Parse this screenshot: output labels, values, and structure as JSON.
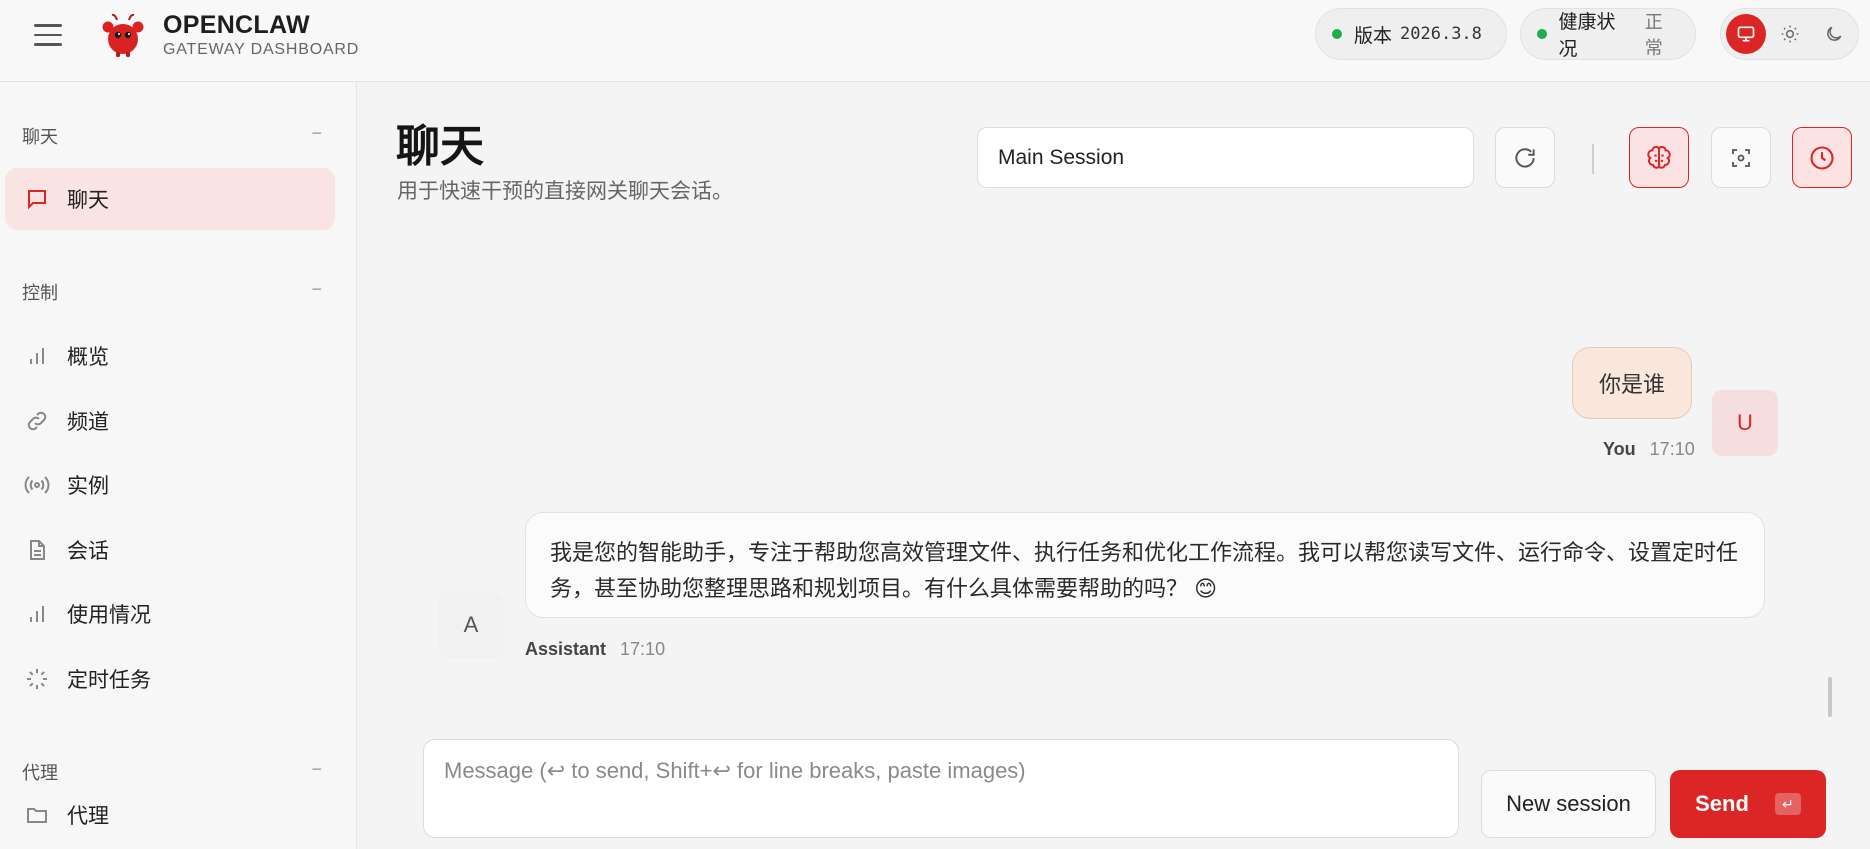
{
  "header": {
    "brand_title": "OPENCLAW",
    "brand_subtitle": "GATEWAY DASHBOARD",
    "version_label": "版本",
    "version_value": "2026.3.8",
    "health_label": "健康状况",
    "health_value": "正常",
    "status_color": "#1fae4e",
    "accent_color": "#dc2626"
  },
  "sidebar": {
    "sections": [
      {
        "title": "聊天",
        "collapse": "−"
      },
      {
        "title": "控制",
        "collapse": "−"
      },
      {
        "title": "代理",
        "collapse": "−"
      }
    ],
    "items": [
      {
        "label": "聊天",
        "icon": "message-icon",
        "active": true
      },
      {
        "label": "概览",
        "icon": "bar-chart-icon"
      },
      {
        "label": "频道",
        "icon": "link-icon"
      },
      {
        "label": "实例",
        "icon": "broadcast-icon"
      },
      {
        "label": "会话",
        "icon": "document-icon"
      },
      {
        "label": "使用情况",
        "icon": "bar-chart-icon"
      },
      {
        "label": "定时任务",
        "icon": "loader-icon"
      },
      {
        "label": "代理",
        "icon": "folder-icon"
      }
    ]
  },
  "main": {
    "title": "聊天",
    "subtitle": "用于快速干预的直接网关聊天会话。",
    "session_value": "Main Session",
    "toolbar_icons": [
      "refresh-icon",
      "brain-icon",
      "focus-icon",
      "clock-icon"
    ]
  },
  "chat": {
    "messages": [
      {
        "role": "user",
        "avatar": "U",
        "text": "你是谁",
        "sender": "You",
        "time": "17:10"
      },
      {
        "role": "assistant",
        "avatar": "A",
        "text": "我是您的智能助手，专注于帮助您高效管理文件、执行任务和优化工作流程。我可以帮您读写文件、运行命令、设置定时任务，甚至协助您整理思路和规划项目。有什么具体需要帮助的吗？ 😊",
        "sender": "Assistant",
        "time": "17:10"
      }
    ]
  },
  "composer": {
    "placeholder": "Message (↩ to send, Shift+↩ for line breaks, paste images)",
    "new_session_label": "New session",
    "send_label": "Send",
    "send_key_hint": "↵"
  }
}
